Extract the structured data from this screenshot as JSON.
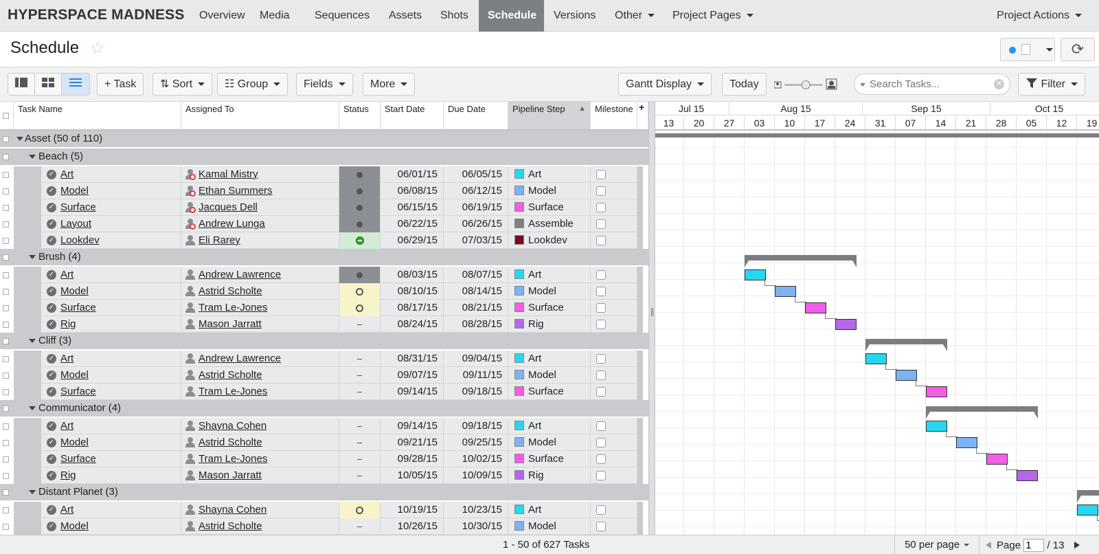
{
  "nav": {
    "brand": "HYPERSPACE MADNESS",
    "tabs": [
      "Overview",
      "Media",
      "Sequences",
      "Assets",
      "Shots",
      "Schedule",
      "Versions",
      "Other",
      "Project Pages"
    ],
    "active": "Schedule",
    "actions": "Project Actions"
  },
  "header": {
    "title": "Schedule"
  },
  "toolbar": {
    "task": "+ Task",
    "sort": "Sort",
    "group": "Group",
    "fields": "Fields",
    "more": "More",
    "gantt_display": "Gantt Display",
    "today": "Today",
    "search_placeholder": "Search Tasks...",
    "filter": "Filter"
  },
  "columns": [
    "Task Name",
    "Assigned To",
    "Status",
    "Start Date",
    "Due Date",
    "Pipeline Step",
    "Milestone"
  ],
  "root_group": "Asset (50 of 110)",
  "step_colors": {
    "Art": "#27d7f0",
    "Model": "#7eb2f2",
    "Surface": "#f45de6",
    "Assemble": "#7e7e7e",
    "Lookdev": "#7a0a1e",
    "Rig": "#b566ea"
  },
  "groups": [
    {
      "label": "Beach (5)",
      "tasks": [
        {
          "name": "Art",
          "assignee": "Kamal Mistry",
          "blocked": true,
          "status": "dot",
          "start": "06/01/15",
          "due": "06/05/15",
          "step": "Art"
        },
        {
          "name": "Model",
          "assignee": "Ethan Summers",
          "blocked": true,
          "status": "dot",
          "start": "06/08/15",
          "due": "06/12/15",
          "step": "Model"
        },
        {
          "name": "Surface",
          "assignee": "Jacques Dell",
          "blocked": true,
          "status": "dot",
          "start": "06/15/15",
          "due": "06/19/15",
          "step": "Surface"
        },
        {
          "name": "Layout",
          "assignee": "Andrew Lunga",
          "blocked": true,
          "status": "dot",
          "start": "06/22/15",
          "due": "06/26/15",
          "step": "Assemble"
        },
        {
          "name": "Lookdev",
          "assignee": "Eli Rarey",
          "blocked": false,
          "status": "green",
          "start": "06/29/15",
          "due": "07/03/15",
          "step": "Lookdev"
        }
      ]
    },
    {
      "label": "Brush (4)",
      "tasks": [
        {
          "name": "Art",
          "assignee": "Andrew Lawrence",
          "blocked": false,
          "status": "dot",
          "start": "08/03/15",
          "due": "08/07/15",
          "step": "Art"
        },
        {
          "name": "Model",
          "assignee": "Astrid Scholte",
          "blocked": false,
          "status": "ring",
          "start": "08/10/15",
          "due": "08/14/15",
          "step": "Model"
        },
        {
          "name": "Surface",
          "assignee": "Tram Le-Jones",
          "blocked": false,
          "status": "ring",
          "start": "08/17/15",
          "due": "08/21/15",
          "step": "Surface"
        },
        {
          "name": "Rig",
          "assignee": "Mason Jarratt",
          "blocked": false,
          "status": "dash",
          "start": "08/24/15",
          "due": "08/28/15",
          "step": "Rig"
        }
      ]
    },
    {
      "label": "Cliff (3)",
      "tasks": [
        {
          "name": "Art",
          "assignee": "Andrew Lawrence",
          "blocked": false,
          "status": "dash",
          "start": "08/31/15",
          "due": "09/04/15",
          "step": "Art"
        },
        {
          "name": "Model",
          "assignee": "Astrid Scholte",
          "blocked": false,
          "status": "dash",
          "start": "09/07/15",
          "due": "09/11/15",
          "step": "Model"
        },
        {
          "name": "Surface",
          "assignee": "Tram Le-Jones",
          "blocked": false,
          "status": "dash",
          "start": "09/14/15",
          "due": "09/18/15",
          "step": "Surface"
        }
      ]
    },
    {
      "label": "Communicator (4)",
      "tasks": [
        {
          "name": "Art",
          "assignee": "Shayna Cohen",
          "blocked": false,
          "status": "dash",
          "start": "09/14/15",
          "due": "09/18/15",
          "step": "Art"
        },
        {
          "name": "Model",
          "assignee": "Astrid Scholte",
          "blocked": false,
          "status": "dash",
          "start": "09/21/15",
          "due": "09/25/15",
          "step": "Model"
        },
        {
          "name": "Surface",
          "assignee": "Tram Le-Jones",
          "blocked": false,
          "status": "dash",
          "start": "09/28/15",
          "due": "10/02/15",
          "step": "Surface"
        },
        {
          "name": "Rig",
          "assignee": "Mason Jarratt",
          "blocked": false,
          "status": "dash",
          "start": "10/05/15",
          "due": "10/09/15",
          "step": "Rig"
        }
      ]
    },
    {
      "label": "Distant Planet (3)",
      "tasks": [
        {
          "name": "Art",
          "assignee": "Shayna Cohen",
          "blocked": false,
          "status": "ring",
          "start": "10/19/15",
          "due": "10/23/15",
          "step": "Art"
        },
        {
          "name": "Model",
          "assignee": "Astrid Scholte",
          "blocked": false,
          "status": "dash",
          "start": "10/26/15",
          "due": "10/30/15",
          "step": "Model"
        }
      ]
    }
  ],
  "gantt": {
    "months": [
      "Jul 15",
      "Aug 15",
      "Sep 15",
      "Oct 15"
    ],
    "weeks": [
      "13",
      "20",
      "27",
      "03",
      "10",
      "17",
      "24",
      "31",
      "07",
      "14",
      "21",
      "28",
      "05",
      "12",
      "19"
    ]
  },
  "footer": {
    "summary": "1 - 50 of 627 Tasks",
    "per_page": "50 per page",
    "page_label": "Page",
    "page": "1",
    "total_pages": "/ 13"
  }
}
